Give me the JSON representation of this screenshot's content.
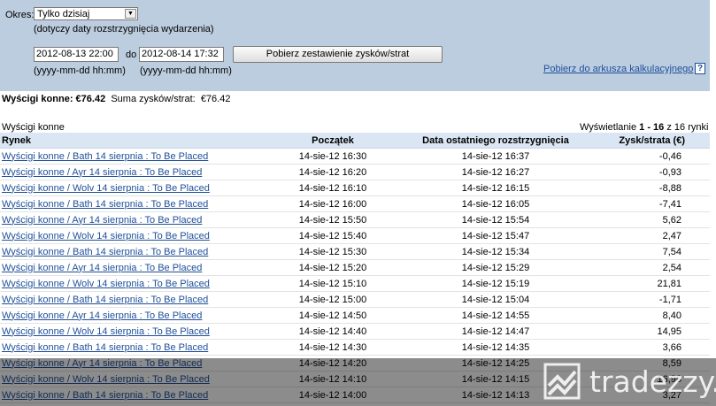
{
  "filter": {
    "period_label": "Okres:",
    "period_value": "Tylko dzisiaj",
    "period_hint": "(dotyczy daty rozstrzygnięcia wydarzenia)",
    "from_value": "2012-08-13 22:00",
    "to_label": "do",
    "to_value": "2012-08-14 17:32",
    "from_format": "(yyyy-mm-dd hh:mm)",
    "to_format": "(yyyy-mm-dd hh:mm)",
    "fetch_button": "Pobierz zestawienie zysków/strat",
    "spreadsheet_link": "Pobierz do arkusza kalkulacyjnego",
    "help_icon": "?"
  },
  "summary": {
    "category": "Wyścigi konne:",
    "category_value": "€76.42",
    "total_label": "Suma zysków/strat:",
    "total_value": "€76.42"
  },
  "table": {
    "caption": "Wyścigi konne",
    "paging_prefix": "Wyświetlanie",
    "paging_range": "1 - 16",
    "paging_suffix": "z 16 rynki",
    "headers": [
      "Rynek",
      "Początek",
      "Data ostatniego rozstrzygnięcia",
      "Zysk/strata (€)"
    ],
    "rows": [
      [
        "Wyścigi konne / Bath 14 sierpnia : To Be Placed",
        "14-sie-12 16:30",
        "14-sie-12 16:37",
        "-0,46"
      ],
      [
        "Wyścigi konne / Ayr 14 sierpnia : To Be Placed",
        "14-sie-12 16:20",
        "14-sie-12 16:27",
        "-0,93"
      ],
      [
        "Wyścigi konne / Wolv 14 sierpnia : To Be Placed",
        "14-sie-12 16:10",
        "14-sie-12 16:15",
        "-8,88"
      ],
      [
        "Wyścigi konne / Bath 14 sierpnia : To Be Placed",
        "14-sie-12 16:00",
        "14-sie-12 16:05",
        "-7,41"
      ],
      [
        "Wyścigi konne / Ayr 14 sierpnia : To Be Placed",
        "14-sie-12 15:50",
        "14-sie-12 15:54",
        "5,62"
      ],
      [
        "Wyścigi konne / Wolv 14 sierpnia : To Be Placed",
        "14-sie-12 15:40",
        "14-sie-12 15:47",
        "2,47"
      ],
      [
        "Wyścigi konne / Bath 14 sierpnia : To Be Placed",
        "14-sie-12 15:30",
        "14-sie-12 15:34",
        "7,54"
      ],
      [
        "Wyścigi konne / Ayr 14 sierpnia : To Be Placed",
        "14-sie-12 15:20",
        "14-sie-12 15:29",
        "2,54"
      ],
      [
        "Wyścigi konne / Wolv 14 sierpnia : To Be Placed",
        "14-sie-12 15:10",
        "14-sie-12 15:19",
        "21,81"
      ],
      [
        "Wyścigi konne / Bath 14 sierpnia : To Be Placed",
        "14-sie-12 15:00",
        "14-sie-12 15:04",
        "-1,71"
      ],
      [
        "Wyścigi konne / Ayr 14 sierpnia : To Be Placed",
        "14-sie-12 14:50",
        "14-sie-12 14:55",
        "8,40"
      ],
      [
        "Wyścigi konne / Wolv 14 sierpnia : To Be Placed",
        "14-sie-12 14:40",
        "14-sie-12 14:47",
        "14,95"
      ],
      [
        "Wyścigi konne / Bath 14 sierpnia : To Be Placed",
        "14-sie-12 14:30",
        "14-sie-12 14:35",
        "3,66"
      ],
      [
        "Wyścigi konne / Ayr 14 sierpnia : To Be Placed",
        "14-sie-12 14:20",
        "14-sie-12 14:25",
        "8,59"
      ],
      [
        "Wyścigi konne / Wolv 14 sierpnia : To Be Placed",
        "14-sie-12 14:10",
        "14-sie-12 14:15",
        "16,96"
      ],
      [
        "Wyścigi konne / Bath 14 sierpnia : To Be Placed",
        "14-sie-12 14:00",
        "14-sie-12 14:13",
        "3,27"
      ]
    ]
  },
  "watermark": {
    "text": "tradezzy.pl"
  }
}
